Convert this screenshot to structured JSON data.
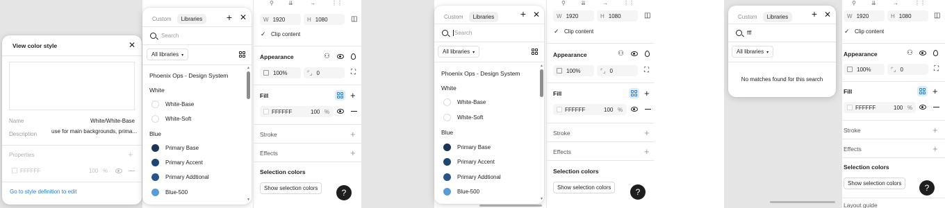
{
  "style_dialog": {
    "title": "View color style",
    "name_label": "Name",
    "name_value": "White/White-Base",
    "description_label": "Description",
    "description_value": "use for main backgrounds, prima...",
    "properties_label": "Properties",
    "prop_hex": "FFFFFF",
    "prop_opacity": "100",
    "prop_percent": "%",
    "link": "Go to style definition to edit"
  },
  "picker": {
    "tab_custom": "Custom",
    "tab_libraries": "Libraries",
    "search_placeholder": "Search",
    "filter_label": "All libraries",
    "library_title": "Phoenix Ops - Design System",
    "groups": [
      {
        "label": "White",
        "items": [
          "White-Base",
          "White-Soft"
        ]
      },
      {
        "label": "Blue",
        "items": [
          "Primary Base",
          "Primary Accent",
          "Primary Addtional",
          "Blue-500"
        ]
      }
    ]
  },
  "picker3": {
    "search_value": "fff",
    "empty_message": "No matches found for this search"
  },
  "colors": {
    "white": "#ffffff",
    "primary_base": "#1b3557",
    "primary_accent": "#1f4573",
    "primary_additional": "#27558a",
    "blue_500": "#5a9bd4",
    "link": "#2a7de1"
  },
  "panel": {
    "width_label": "W",
    "width_value": "1920",
    "height_label": "H",
    "height_value": "1080",
    "clip_content": "Clip content",
    "appearance": "Appearance",
    "opacity_value": "100%",
    "radius_value": "0",
    "fill": "Fill",
    "fill_hex": "FFFFFF",
    "fill_opacity": "100",
    "fill_percent": "%",
    "stroke": "Stroke",
    "effects": "Effects",
    "selection_colors": "Selection colors",
    "show_selection_colors": "Show selection colors",
    "layout_guide": "Layout guide",
    "help": "?"
  }
}
